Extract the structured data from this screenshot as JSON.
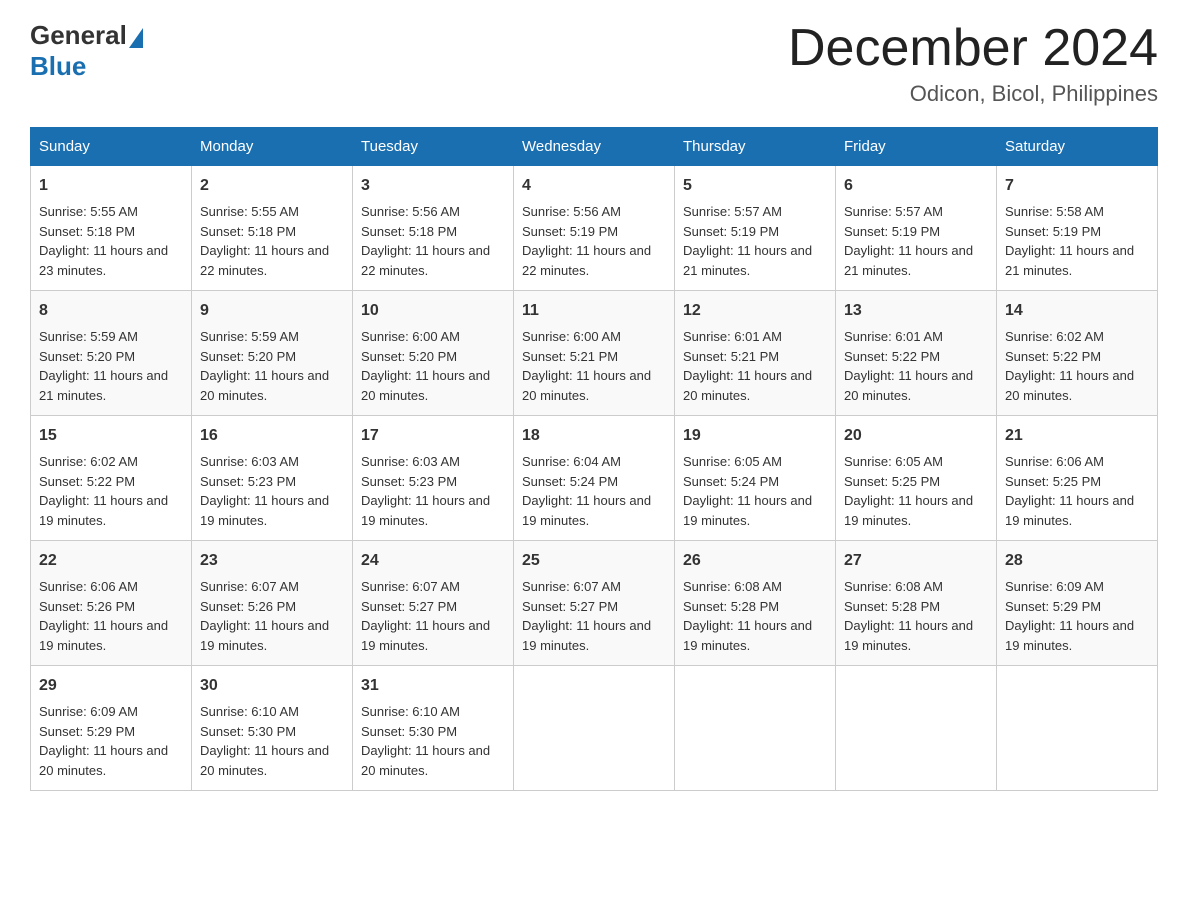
{
  "logo": {
    "general": "General",
    "blue": "Blue"
  },
  "title": "December 2024",
  "location": "Odicon, Bicol, Philippines",
  "days_header": [
    "Sunday",
    "Monday",
    "Tuesday",
    "Wednesday",
    "Thursday",
    "Friday",
    "Saturday"
  ],
  "weeks": [
    [
      {
        "day": "1",
        "sunrise": "5:55 AM",
        "sunset": "5:18 PM",
        "daylight": "11 hours and 23 minutes."
      },
      {
        "day": "2",
        "sunrise": "5:55 AM",
        "sunset": "5:18 PM",
        "daylight": "11 hours and 22 minutes."
      },
      {
        "day": "3",
        "sunrise": "5:56 AM",
        "sunset": "5:18 PM",
        "daylight": "11 hours and 22 minutes."
      },
      {
        "day": "4",
        "sunrise": "5:56 AM",
        "sunset": "5:19 PM",
        "daylight": "11 hours and 22 minutes."
      },
      {
        "day": "5",
        "sunrise": "5:57 AM",
        "sunset": "5:19 PM",
        "daylight": "11 hours and 21 minutes."
      },
      {
        "day": "6",
        "sunrise": "5:57 AM",
        "sunset": "5:19 PM",
        "daylight": "11 hours and 21 minutes."
      },
      {
        "day": "7",
        "sunrise": "5:58 AM",
        "sunset": "5:19 PM",
        "daylight": "11 hours and 21 minutes."
      }
    ],
    [
      {
        "day": "8",
        "sunrise": "5:59 AM",
        "sunset": "5:20 PM",
        "daylight": "11 hours and 21 minutes."
      },
      {
        "day": "9",
        "sunrise": "5:59 AM",
        "sunset": "5:20 PM",
        "daylight": "11 hours and 20 minutes."
      },
      {
        "day": "10",
        "sunrise": "6:00 AM",
        "sunset": "5:20 PM",
        "daylight": "11 hours and 20 minutes."
      },
      {
        "day": "11",
        "sunrise": "6:00 AM",
        "sunset": "5:21 PM",
        "daylight": "11 hours and 20 minutes."
      },
      {
        "day": "12",
        "sunrise": "6:01 AM",
        "sunset": "5:21 PM",
        "daylight": "11 hours and 20 minutes."
      },
      {
        "day": "13",
        "sunrise": "6:01 AM",
        "sunset": "5:22 PM",
        "daylight": "11 hours and 20 minutes."
      },
      {
        "day": "14",
        "sunrise": "6:02 AM",
        "sunset": "5:22 PM",
        "daylight": "11 hours and 20 minutes."
      }
    ],
    [
      {
        "day": "15",
        "sunrise": "6:02 AM",
        "sunset": "5:22 PM",
        "daylight": "11 hours and 19 minutes."
      },
      {
        "day": "16",
        "sunrise": "6:03 AM",
        "sunset": "5:23 PM",
        "daylight": "11 hours and 19 minutes."
      },
      {
        "day": "17",
        "sunrise": "6:03 AM",
        "sunset": "5:23 PM",
        "daylight": "11 hours and 19 minutes."
      },
      {
        "day": "18",
        "sunrise": "6:04 AM",
        "sunset": "5:24 PM",
        "daylight": "11 hours and 19 minutes."
      },
      {
        "day": "19",
        "sunrise": "6:05 AM",
        "sunset": "5:24 PM",
        "daylight": "11 hours and 19 minutes."
      },
      {
        "day": "20",
        "sunrise": "6:05 AM",
        "sunset": "5:25 PM",
        "daylight": "11 hours and 19 minutes."
      },
      {
        "day": "21",
        "sunrise": "6:06 AM",
        "sunset": "5:25 PM",
        "daylight": "11 hours and 19 minutes."
      }
    ],
    [
      {
        "day": "22",
        "sunrise": "6:06 AM",
        "sunset": "5:26 PM",
        "daylight": "11 hours and 19 minutes."
      },
      {
        "day": "23",
        "sunrise": "6:07 AM",
        "sunset": "5:26 PM",
        "daylight": "11 hours and 19 minutes."
      },
      {
        "day": "24",
        "sunrise": "6:07 AM",
        "sunset": "5:27 PM",
        "daylight": "11 hours and 19 minutes."
      },
      {
        "day": "25",
        "sunrise": "6:07 AM",
        "sunset": "5:27 PM",
        "daylight": "11 hours and 19 minutes."
      },
      {
        "day": "26",
        "sunrise": "6:08 AM",
        "sunset": "5:28 PM",
        "daylight": "11 hours and 19 minutes."
      },
      {
        "day": "27",
        "sunrise": "6:08 AM",
        "sunset": "5:28 PM",
        "daylight": "11 hours and 19 minutes."
      },
      {
        "day": "28",
        "sunrise": "6:09 AM",
        "sunset": "5:29 PM",
        "daylight": "11 hours and 19 minutes."
      }
    ],
    [
      {
        "day": "29",
        "sunrise": "6:09 AM",
        "sunset": "5:29 PM",
        "daylight": "11 hours and 20 minutes."
      },
      {
        "day": "30",
        "sunrise": "6:10 AM",
        "sunset": "5:30 PM",
        "daylight": "11 hours and 20 minutes."
      },
      {
        "day": "31",
        "sunrise": "6:10 AM",
        "sunset": "5:30 PM",
        "daylight": "11 hours and 20 minutes."
      },
      null,
      null,
      null,
      null
    ]
  ],
  "labels": {
    "sunrise": "Sunrise:",
    "sunset": "Sunset:",
    "daylight": "Daylight:"
  }
}
